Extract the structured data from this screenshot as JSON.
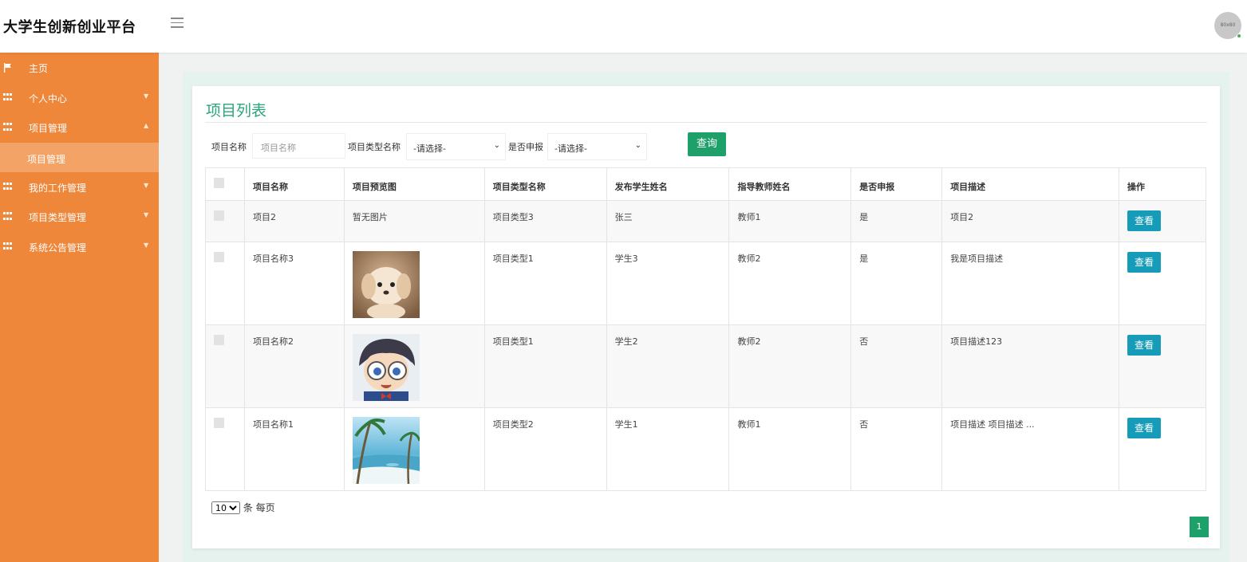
{
  "header": {
    "brand": "大学生创新创业平台",
    "avatar_text": "80x80"
  },
  "sidebar": {
    "items": [
      {
        "label": "主页",
        "icon": "flag-icon"
      },
      {
        "label": "个人中心",
        "icon": "grid-icon"
      },
      {
        "label": "项目管理",
        "icon": "grid-icon",
        "expanded": true
      },
      {
        "label": "项目管理",
        "sub": true
      },
      {
        "label": "我的工作管理",
        "icon": "grid-icon"
      },
      {
        "label": "项目类型管理",
        "icon": "grid-icon"
      },
      {
        "label": "系统公告管理",
        "icon": "grid-icon"
      }
    ]
  },
  "main": {
    "title": "项目列表",
    "search": {
      "name_label": "项目名称",
      "name_placeholder": "项目名称",
      "type_label": "项目类型名称",
      "type_selected": "-请选择-",
      "declare_label": "是否申报",
      "declare_selected": "-请选择-",
      "query_button": "查询"
    },
    "table": {
      "columns": [
        "项目名称",
        "项目预览图",
        "项目类型名称",
        "发布学生姓名",
        "指导教师姓名",
        "是否申报",
        "项目描述",
        "操作"
      ],
      "rows": [
        {
          "name": "项目2",
          "preview": "暂无图片",
          "type": "项目类型3",
          "student": "张三",
          "teacher": "教师1",
          "declared": "是",
          "desc": "项目2",
          "action": "查看"
        },
        {
          "name": "项目名称3",
          "preview": "",
          "preview_image": "puppy",
          "type": "项目类型1",
          "student": "学生3",
          "teacher": "教师2",
          "declared": "是",
          "desc": "我是项目描述",
          "action": "查看"
        },
        {
          "name": "项目名称2",
          "preview": "",
          "preview_image": "cartoon-boy",
          "type": "项目类型1",
          "student": "学生2",
          "teacher": "教师2",
          "declared": "否",
          "desc": "项目描述123",
          "action": "查看"
        },
        {
          "name": "项目名称1",
          "preview": "",
          "preview_image": "beach",
          "type": "项目类型2",
          "student": "学生1",
          "teacher": "教师1",
          "declared": "否",
          "desc": "项目描述 项目描述 ...",
          "action": "查看"
        }
      ]
    },
    "pagination": {
      "page_size": "10",
      "page_size_suffix": "条 每页",
      "current_page": "1"
    }
  },
  "colors": {
    "sidebar": "#ee873a",
    "sidebar_sub": "#f3a365",
    "title": "#2aa57a",
    "query_button": "#1ea06a",
    "view_button": "#169cb8"
  }
}
